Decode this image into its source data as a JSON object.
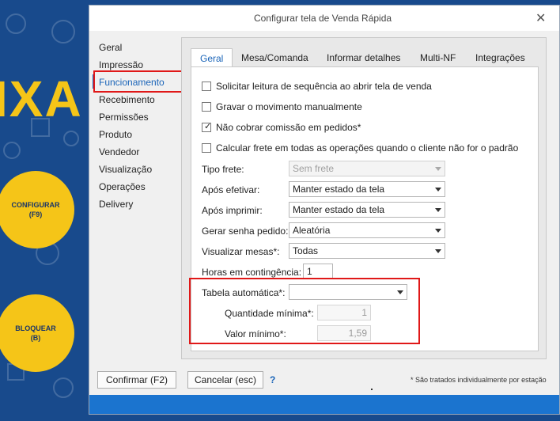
{
  "background": {
    "big_text": "IXA",
    "configure_label": "CONFIGURAR",
    "configure_key": "(F9)",
    "lock_label": "BLOQUEAR",
    "lock_key": "(B)",
    "accent": "#f5c518"
  },
  "dialog": {
    "title": "Configurar tela de Venda Rápida",
    "close_icon": "close-icon"
  },
  "sidebar": {
    "items": [
      {
        "label": "Geral"
      },
      {
        "label": "Impressão"
      },
      {
        "label": "Funcionamento"
      },
      {
        "label": "Recebimento"
      },
      {
        "label": "Permissões"
      },
      {
        "label": "Produto"
      },
      {
        "label": "Vendedor"
      },
      {
        "label": "Visualização"
      },
      {
        "label": "Operações"
      },
      {
        "label": "Delivery"
      }
    ],
    "selected": "Funcionamento"
  },
  "tabs": [
    {
      "label": "Geral"
    },
    {
      "label": "Mesa/Comanda"
    },
    {
      "label": "Informar detalhes"
    },
    {
      "label": "Multi-NF"
    },
    {
      "label": "Integrações"
    }
  ],
  "checkboxes": [
    {
      "label": "Solicitar leitura de sequência ao abrir tela de venda",
      "checked": false
    },
    {
      "label": "Gravar o movimento manualmente",
      "checked": false
    },
    {
      "label": "Não cobrar comissão em pedidos*",
      "checked": true
    },
    {
      "label": "Calcular frete em todas as operações quando o cliente não for o padrão",
      "checked": false
    }
  ],
  "fields": {
    "tipo_frete": {
      "label": "Tipo frete:",
      "value": "Sem frete"
    },
    "apos_efetivar": {
      "label": "Após efetivar:",
      "value": "Manter estado da tela"
    },
    "apos_imprimir": {
      "label": "Após imprimir:",
      "value": "Manter estado da tela"
    },
    "gerar_senha": {
      "label": "Gerar senha pedido:",
      "value": "Aleatória"
    },
    "visualizar_mesas": {
      "label": "Visualizar mesas*:",
      "value": "Todas"
    },
    "horas_contingencia": {
      "label": "Horas em contingência:",
      "value": "1"
    },
    "tabela_automatica": {
      "label": "Tabela automática*:",
      "value": ""
    },
    "quantidade_minima": {
      "label": "Quantidade mínima*:",
      "value": "1"
    },
    "valor_minimo": {
      "label": "Valor mínimo*:",
      "value": "1,59"
    }
  },
  "footer": {
    "confirm": "Confirmar (F2)",
    "cancel": "Cancelar (esc)",
    "help": "?",
    "note": "* São tratados individualmente por estação"
  },
  "colors": {
    "accent_blue": "#1a64b8",
    "highlight_red": "#e01818",
    "statusbar": "#1b74cf"
  }
}
